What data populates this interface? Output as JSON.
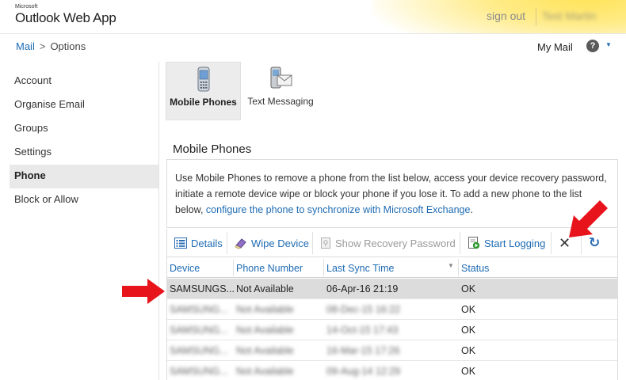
{
  "header": {
    "logo_small": "Microsoft",
    "logo_main": "Outlook Web App",
    "signout": "sign out",
    "username": "Test Martin"
  },
  "breadcrumb": {
    "root": "Mail",
    "separator": ">",
    "current": "Options"
  },
  "top_right": {
    "my_mail": "My Mail",
    "help_icon": "help-icon",
    "help_glyph": "?",
    "caret": "▼"
  },
  "nav": {
    "items": [
      {
        "label": "Account"
      },
      {
        "label": "Organise Email"
      },
      {
        "label": "Groups"
      },
      {
        "label": "Settings"
      },
      {
        "label": "Phone",
        "active": true
      },
      {
        "label": "Block or Allow"
      }
    ]
  },
  "tabs": [
    {
      "label": "Mobile Phones",
      "icon": "mobile-phone-icon",
      "active": true
    },
    {
      "label": "Text Messaging",
      "icon": "text-messaging-icon",
      "active": false
    }
  ],
  "section": {
    "title": "Mobile Phones",
    "description": "Use Mobile Phones to remove a phone from the list below, access your device recovery password, initiate a remote device wipe or block your phone if you lose it. To add a new phone to the list below, ",
    "description_link": "configure the phone to synchronize with Microsoft Exchange",
    "description_end": "."
  },
  "toolbar": {
    "details": "Details",
    "wipe_device": "Wipe Device",
    "show_recovery_password": "Show Recovery Password",
    "start_logging": "Start Logging",
    "delete_icon": "delete-icon",
    "refresh_icon": "refresh-icon",
    "delete_glyph": "✕",
    "refresh_glyph": "↻"
  },
  "table": {
    "columns": [
      "Device",
      "Phone Number",
      "Last Sync Time",
      "Status"
    ],
    "sort_caret": "▼",
    "rows": [
      {
        "device": "SAMSUNGS...",
        "phone": "Not Available",
        "sync": "06-Apr-16 21:19",
        "status": "OK",
        "selected": true,
        "blurred": false
      },
      {
        "device": "SAMSUNG...",
        "phone": "Not Available",
        "sync": "08-Dec-15 16:22",
        "status": "OK",
        "selected": false,
        "blurred": true
      },
      {
        "device": "SAMSUNG...",
        "phone": "Not Available",
        "sync": "14-Oct-15 17:43",
        "status": "OK",
        "selected": false,
        "blurred": true
      },
      {
        "device": "SAMSUNG...",
        "phone": "Not Available",
        "sync": "16-Mar-15 17:26",
        "status": "OK",
        "selected": false,
        "blurred": true
      },
      {
        "device": "SAMSUNG...",
        "phone": "Not Available",
        "sync": "09-Aug-14 12:29",
        "status": "OK",
        "selected": false,
        "blurred": true
      }
    ]
  },
  "colors": {
    "link": "#1e6bb3",
    "selected_row": "#dcdcdc",
    "arrow": "#e8141b",
    "header_glow": "#ffe45a"
  }
}
